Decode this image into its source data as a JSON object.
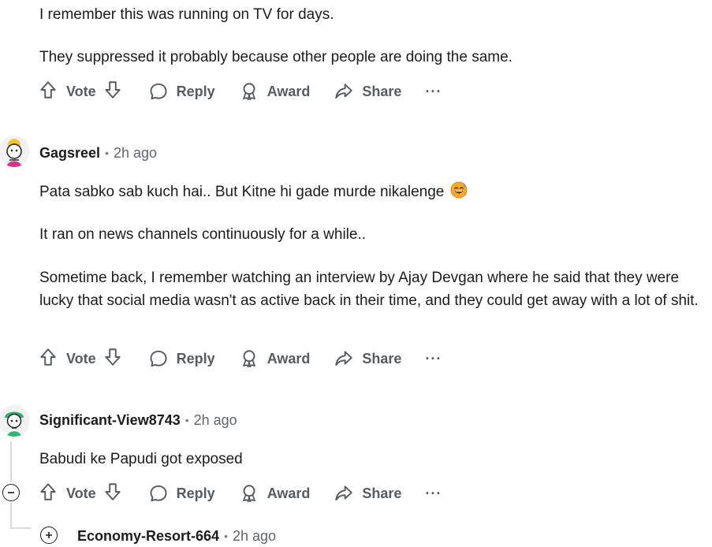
{
  "comments": [
    {
      "lines": [
        "I remember this was running on TV for days.",
        "They suppressed it probably because other people are doing the same."
      ]
    },
    {
      "author": "Gagsreel",
      "time": "2h ago",
      "lines": [
        "Pata sabko sab kuch hai.. But Kitne hi gade murde nikalenge",
        "It ran on news channels continuously for a while..",
        "Sometime back, I remember watching an interview by Ajay Devgan where he said that they were lucky that social media wasn't as active back in their time, and they could get away with a lot of shit."
      ],
      "emoji": "sweat-smile-emoji"
    },
    {
      "author": "Significant-View8743",
      "time": "2h ago",
      "lines": [
        "Babudi ke Papudi got exposed"
      ]
    },
    {
      "author": "Economy-Resort-664",
      "time": "2h ago"
    }
  ],
  "actions": {
    "vote": "Vote",
    "reply": "Reply",
    "award": "Award",
    "share": "Share",
    "more": "···"
  },
  "icons": [
    "upvote-icon",
    "downvote-icon",
    "reply-icon",
    "award-icon",
    "share-icon",
    "more-icon",
    "collapse-icon",
    "expand-icon"
  ],
  "colors": {
    "text": "#1c1c1c",
    "muted": "#555c61",
    "thread_line": "#d7dadc"
  }
}
